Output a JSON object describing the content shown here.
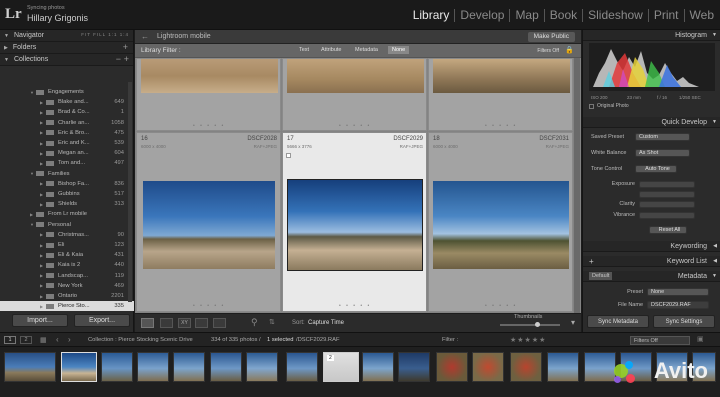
{
  "app": {
    "logo": "Lr",
    "sync_status": "Syncing photos",
    "user": "Hillary Grigonis"
  },
  "modules": [
    "Library",
    "Develop",
    "Map",
    "Book",
    "Slideshow",
    "Print",
    "Web"
  ],
  "left_panel": {
    "navigator": "Navigator",
    "navigator_options": "FIT  FILL  1:1  1:4",
    "folders": "Folders",
    "collections": "Collections",
    "tree": [
      {
        "label": "Engagements",
        "count": ""
      },
      {
        "label": "Blake and...",
        "count": "649"
      },
      {
        "label": "Brad & Co...",
        "count": "1"
      },
      {
        "label": "Charlie an...",
        "count": "1058"
      },
      {
        "label": "Eric & Bro...",
        "count": "475"
      },
      {
        "label": "Eric and K...",
        "count": "539"
      },
      {
        "label": "Megan an...",
        "count": "604"
      },
      {
        "label": "Tom and...",
        "count": "497"
      },
      {
        "label": "Families",
        "count": ""
      },
      {
        "label": "Bishop Fa...",
        "count": "836"
      },
      {
        "label": "Gubbins",
        "count": "517"
      },
      {
        "label": "Shields",
        "count": "313"
      },
      {
        "label": "From Lr mobile",
        "count": ""
      },
      {
        "label": "Personal",
        "count": ""
      },
      {
        "label": "Christmas...",
        "count": "90"
      },
      {
        "label": "Eli",
        "count": "123"
      },
      {
        "label": "Eli & Kaia",
        "count": "431"
      },
      {
        "label": "Kaia is 2",
        "count": "440"
      },
      {
        "label": "Landscap...",
        "count": "119"
      },
      {
        "label": "New York",
        "count": "469"
      },
      {
        "label": "Ontario",
        "count": "2201"
      },
      {
        "label": "Pierce Sto...",
        "count": "335"
      }
    ],
    "import_label": "Import...",
    "export_label": "Export..."
  },
  "center": {
    "mobile_label": "Lightroom mobile",
    "make_public": "Make Public",
    "filter_label": "Library Filter :",
    "filter_tabs": [
      "Text",
      "Attribute",
      "Metadata",
      "None"
    ],
    "filters_off": "Filters Off",
    "cells": [
      {
        "num": "16",
        "dim": "6000 x 4000",
        "name": "DSCF2028",
        "type": "RAF+JPEG"
      },
      {
        "num": "17",
        "dim": "5666 x 3776",
        "name": "DSCF2029",
        "type": "RAF+JPEG"
      },
      {
        "num": "18",
        "dim": "6000 x 4000",
        "name": "DSCF2031",
        "type": "RAF+JPEG"
      }
    ],
    "sort_label": "Sort:",
    "sort_value": "Capture Time",
    "thumbnails_label": "Thumbnails"
  },
  "right_panel": {
    "histogram": "Histogram",
    "hist_info": [
      "ISO 200",
      "23 mm",
      "f / 16",
      "1/250 SEC"
    ],
    "original_photo": "Original Photo",
    "quick_develop": "Quick Develop",
    "saved_preset_label": "Saved Preset",
    "saved_preset_value": "Custom",
    "white_balance_label": "White Balance",
    "white_balance_value": "As Shot",
    "tone_control_label": "Tone Control",
    "auto_tone": "Auto Tone",
    "exposure": "Exposure",
    "clarity": "Clarity",
    "vibrance": "Vibrance",
    "reset_all": "Reset All",
    "keywording": "Keywording",
    "keyword_list": "Keyword List",
    "metadata": "Metadata",
    "metadata_preset_mode": "Default",
    "preset_label": "Preset",
    "preset_value": "None",
    "file_name_label": "File Name",
    "file_name_value": "DSCF2029.RAF",
    "sync_metadata": "Sync Metadata",
    "sync_settings": "Sync Settings"
  },
  "filmstrip_bar": {
    "pages": [
      "1",
      "2"
    ],
    "collection": "Collection : Pierce Stocking Scenic Drive",
    "count": "334 of 335 photos /",
    "selected": "1 selected",
    "file": "/DSCF2029.RAF",
    "filter_label": "Filter :",
    "filters_off": "Filters Off"
  },
  "watermark": "Avito",
  "colors": {
    "accent_selected": "#e9e9e9",
    "sky": "#3a6fae",
    "avito_green": "#97cf26",
    "avito_blue": "#00aaff",
    "avito_purple": "#965eeb",
    "avito_red": "#ff4053"
  }
}
